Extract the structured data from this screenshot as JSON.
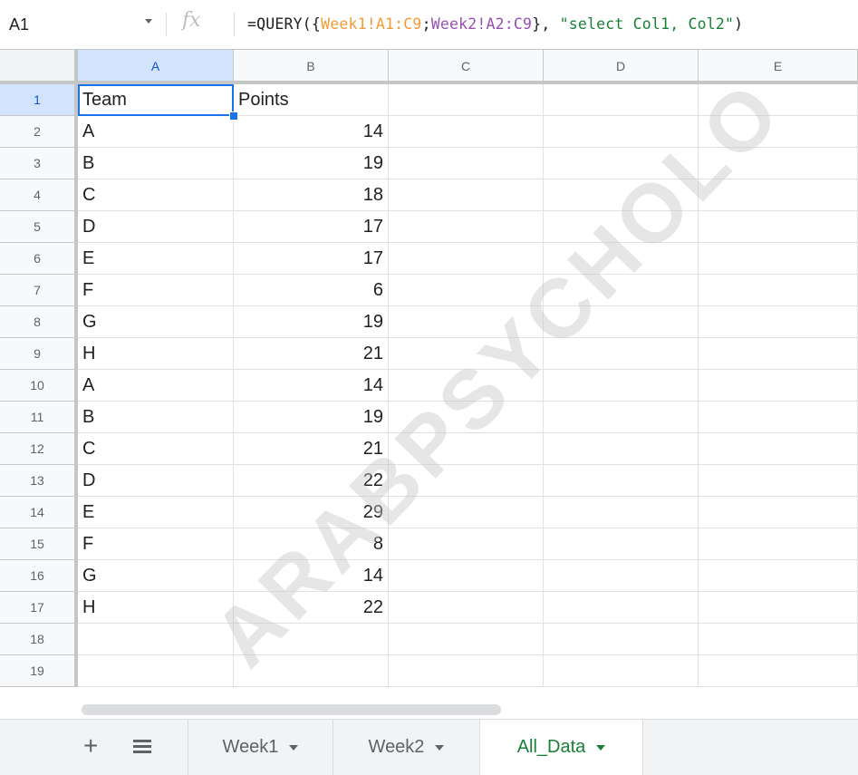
{
  "formula_bar": {
    "cell_ref": "A1",
    "fx_label": "fx",
    "formula_parts": [
      {
        "text": "=QUERY({",
        "style": "default"
      },
      {
        "text": "Week1!A1:C9",
        "style": "range1"
      },
      {
        "text": ";",
        "style": "default"
      },
      {
        "text": "Week2!A2:C9",
        "style": "range2"
      },
      {
        "text": "}, ",
        "style": "default"
      },
      {
        "text": "\"select Col1, Col2\"",
        "style": "string"
      },
      {
        "text": ")",
        "style": "default"
      }
    ]
  },
  "columns": [
    "A",
    "B",
    "C",
    "D",
    "E"
  ],
  "rows": [
    {
      "num": "1",
      "a": "Team",
      "b": "Points"
    },
    {
      "num": "2",
      "a": "A",
      "b": "14"
    },
    {
      "num": "3",
      "a": "B",
      "b": "19"
    },
    {
      "num": "4",
      "a": "C",
      "b": "18"
    },
    {
      "num": "5",
      "a": "D",
      "b": "17"
    },
    {
      "num": "6",
      "a": "E",
      "b": "17"
    },
    {
      "num": "7",
      "a": "F",
      "b": "6"
    },
    {
      "num": "8",
      "a": "G",
      "b": "19"
    },
    {
      "num": "9",
      "a": "H",
      "b": "21"
    },
    {
      "num": "10",
      "a": "A",
      "b": "14"
    },
    {
      "num": "11",
      "a": "B",
      "b": "19"
    },
    {
      "num": "12",
      "a": "C",
      "b": "21"
    },
    {
      "num": "13",
      "a": "D",
      "b": "22"
    },
    {
      "num": "14",
      "a": "E",
      "b": "29"
    },
    {
      "num": "15",
      "a": "F",
      "b": "8"
    },
    {
      "num": "16",
      "a": "G",
      "b": "14"
    },
    {
      "num": "17",
      "a": "H",
      "b": "22"
    },
    {
      "num": "18",
      "a": "",
      "b": ""
    },
    {
      "num": "19",
      "a": "",
      "b": ""
    }
  ],
  "active_cell": "A1",
  "sheet_tabs": [
    {
      "label": "Week1",
      "active": false
    },
    {
      "label": "Week2",
      "active": false
    },
    {
      "label": "All_Data",
      "active": true
    }
  ],
  "icons": {
    "add_sheet": "plus-icon",
    "all_sheets": "list-icon",
    "name_box_dropdown": "caret-down-icon"
  },
  "colors": {
    "accent": "#1a73e8",
    "active_tab": "#188038",
    "range1": "#f29b37",
    "range2": "#9850b6",
    "string": "#188038"
  },
  "watermark": "ARABPSYCHOLO"
}
